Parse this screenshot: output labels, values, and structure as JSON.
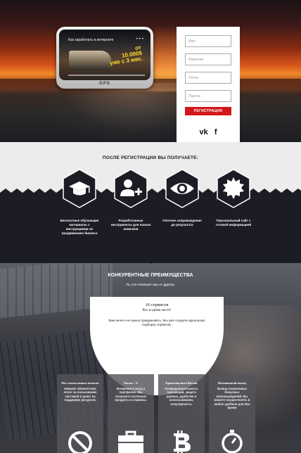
{
  "hero": {
    "video": {
      "title": "Как заработать в интернете",
      "menu": "•••",
      "headline_top": "от",
      "headline_amount": "10.000$",
      "headline_bottom": "уже с 3 мес.",
      "device_label": "GPS"
    },
    "form": {
      "name_placeholder": "Имя",
      "surname_placeholder": "Фамилия",
      "email_placeholder": "Почта",
      "password_placeholder": "Пароль",
      "submit_label": "РЕГИСТРАЦИЯ",
      "social_vk": "vk",
      "social_fb": "f"
    }
  },
  "benefits": {
    "heading": "ПОСЛЕ РЕГИСТРАЦИИ ВЫ ПОЛУЧАЕТЕ:",
    "items": [
      {
        "text": "Бесплатные обучающие материалы с инструкциями по продвижению бизнеса",
        "icon": "graduation-cap-icon"
      },
      {
        "text": "Разработанные инструменты для поиска новичков",
        "icon": "add-user-icon"
      },
      {
        "text": "Плотное сопровождение до результата",
        "icon": "eye-icon"
      },
      {
        "text": "Персональный сайт с готовой информацией",
        "icon": "badge-icon"
      }
    ]
  },
  "advantages": {
    "title": "КОНКУРЕНТНЫЕ ПРЕИМУЩЕСТВА",
    "subtitle": "То, что отличает нас от других.",
    "arc": {
      "title": "16 сервисов",
      "subtitle": "Все в одном месте!",
      "description": "Вам ничего не нужно придумывать. Мы уже создали идеальную подборку сервисов."
    },
    "cards": [
      {
        "title": "Нет ежемесячных взносов",
        "text": "Никаких абонентских оплат за пользование системой и денег на поддержку ресурсов.",
        "icon": "no-icon"
      },
      {
        "title": "Риски = 0",
        "text": "Вложения в вход в портфолио. Вы получаете полезные продукты и сервисы.",
        "icon": "briefcase-icon"
      },
      {
        "title": "Криптовалюта Bitcoin",
        "text": "Конфиденциальность транзакций, защита данных, удобство в использовании, популярность.",
        "icon": "bitcoin-icon"
      },
      {
        "title": "Мгновенный вывод",
        "text": "Вывод полученных бонусных вознаграждений. Вы можете осуществлять в любое удобное для Вас время",
        "icon": "stopwatch-icon"
      }
    ]
  },
  "colors": {
    "accent": "#d2161a",
    "dark": "#1c1d24",
    "light": "#ececec"
  }
}
